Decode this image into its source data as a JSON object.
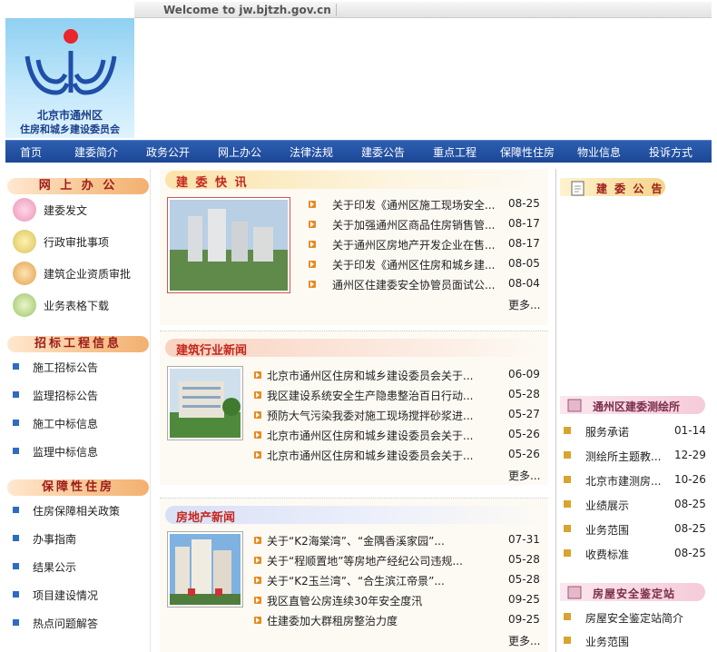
{
  "welcome": "Welcome to jw.bjtzh.gov.cn",
  "logo": {
    "line1": "北京市通州区",
    "line2": "住房和城乡建设委员会"
  },
  "nav": [
    "首页",
    "建委简介",
    "政务公开",
    "网上办公",
    "法律法规",
    "建委公告",
    "重点工程",
    "保障性住房",
    "物业信息",
    "投诉方式"
  ],
  "left": {
    "office_title": "网 上 办 公",
    "office_items": [
      "建委发文",
      "行政审批事项",
      "建筑企业资质审批",
      "业务表格下载"
    ],
    "bid_title": "招标工程信息",
    "bid_items": [
      "施工招标公告",
      "监理招标公告",
      "施工中标信息",
      "监理中标信息"
    ],
    "housing_title": "保障性住房",
    "housing_items": [
      "住房保障相关政策",
      "办事指南",
      "结果公示",
      "项目建设情况",
      "热点问题解答"
    ]
  },
  "quick": {
    "title": "建 委 快 讯",
    "items": [
      {
        "text": "关于印发《通州区施工现场安全...",
        "date": "08-25"
      },
      {
        "text": "关于加强通州区商品住房销售管...",
        "date": "08-17"
      },
      {
        "text": "关于通州区房地产开发企业在售...",
        "date": "08-17"
      },
      {
        "text": "关于印发《通州区住房和城乡建...",
        "date": "08-05"
      },
      {
        "text": "通州区住建委安全协管员面试公...",
        "date": "08-04"
      }
    ],
    "more": "更多..."
  },
  "industry": {
    "title": "建筑行业新闻",
    "items": [
      {
        "text": "北京市通州区住房和城乡建设委员会关于...",
        "date": "06-09"
      },
      {
        "text": "我区建设系统安全生产隐患整治百日行动...",
        "date": "05-28"
      },
      {
        "text": "预防大气污染我委对施工现场搅拌砂浆进...",
        "date": "05-27"
      },
      {
        "text": "北京市通州区住房和城乡建设委员会关于...",
        "date": "05-26"
      },
      {
        "text": "北京市通州区住房和城乡建设委员会关于...",
        "date": "05-26"
      }
    ],
    "more": "更多..."
  },
  "realestate": {
    "title": "房地产新闻",
    "items": [
      {
        "text": "关于“K2海棠湾”、“金隅香溪家园”...",
        "date": "07-31"
      },
      {
        "text": "关于“程顺置地”等房地产经纪公司违规...",
        "date": "05-28"
      },
      {
        "text": "关于“K2玉兰湾”、“合生滨江帝景”...",
        "date": "05-28"
      },
      {
        "text": "我区直管公房连续30年安全度汛",
        "date": "09-25"
      },
      {
        "text": "住建委加大群租房整治力度",
        "date": "09-25"
      }
    ],
    "more": "更多..."
  },
  "right": {
    "notice_title": "建 委 公 告",
    "survey_title": "通州区建委测绘所",
    "survey_items": [
      {
        "text": "服务承诺",
        "date": "01-14"
      },
      {
        "text": "测绘所主题教...",
        "date": "12-29"
      },
      {
        "text": "北京市建测房...",
        "date": "10-26"
      },
      {
        "text": "业绩展示",
        "date": "08-25"
      },
      {
        "text": "业务范围",
        "date": "08-25"
      },
      {
        "text": "收费标准",
        "date": "08-25"
      }
    ],
    "safety_title": "房屋安全鉴定站",
    "safety_items": [
      "房屋安全鉴定站简介",
      "业务范围"
    ]
  }
}
